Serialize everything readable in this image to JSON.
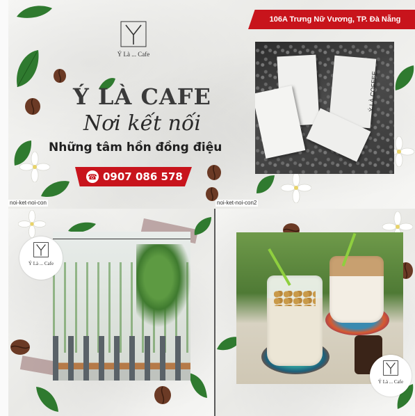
{
  "brand": {
    "logo_mark": "Y",
    "logo_name": "Ý Là ... Cafe"
  },
  "hero": {
    "title": "Ý LÀ CAFE",
    "script_line": "Nơi kết nối",
    "slogan": "Những tâm hồn đồng điệu",
    "phone": "0907 086 578",
    "address": "106A Trưng Nữ Vương, TP. Đà Nẵng",
    "bag_label": "Ý LÀ COFFEE"
  },
  "file_labels": {
    "top_left": "noi-ket-noi-con",
    "top_right": "noi-ket-noi-con2"
  },
  "colors": {
    "accent_red": "#c8141c",
    "leaf_green": "#2f7a2f",
    "bean_brown": "#6b3a25",
    "tape": "#9a6e6e"
  },
  "icons": [
    "phone-icon",
    "coffee-bean-icon",
    "leaf-icon",
    "white-flower-icon",
    "arrow-logo-icon"
  ]
}
